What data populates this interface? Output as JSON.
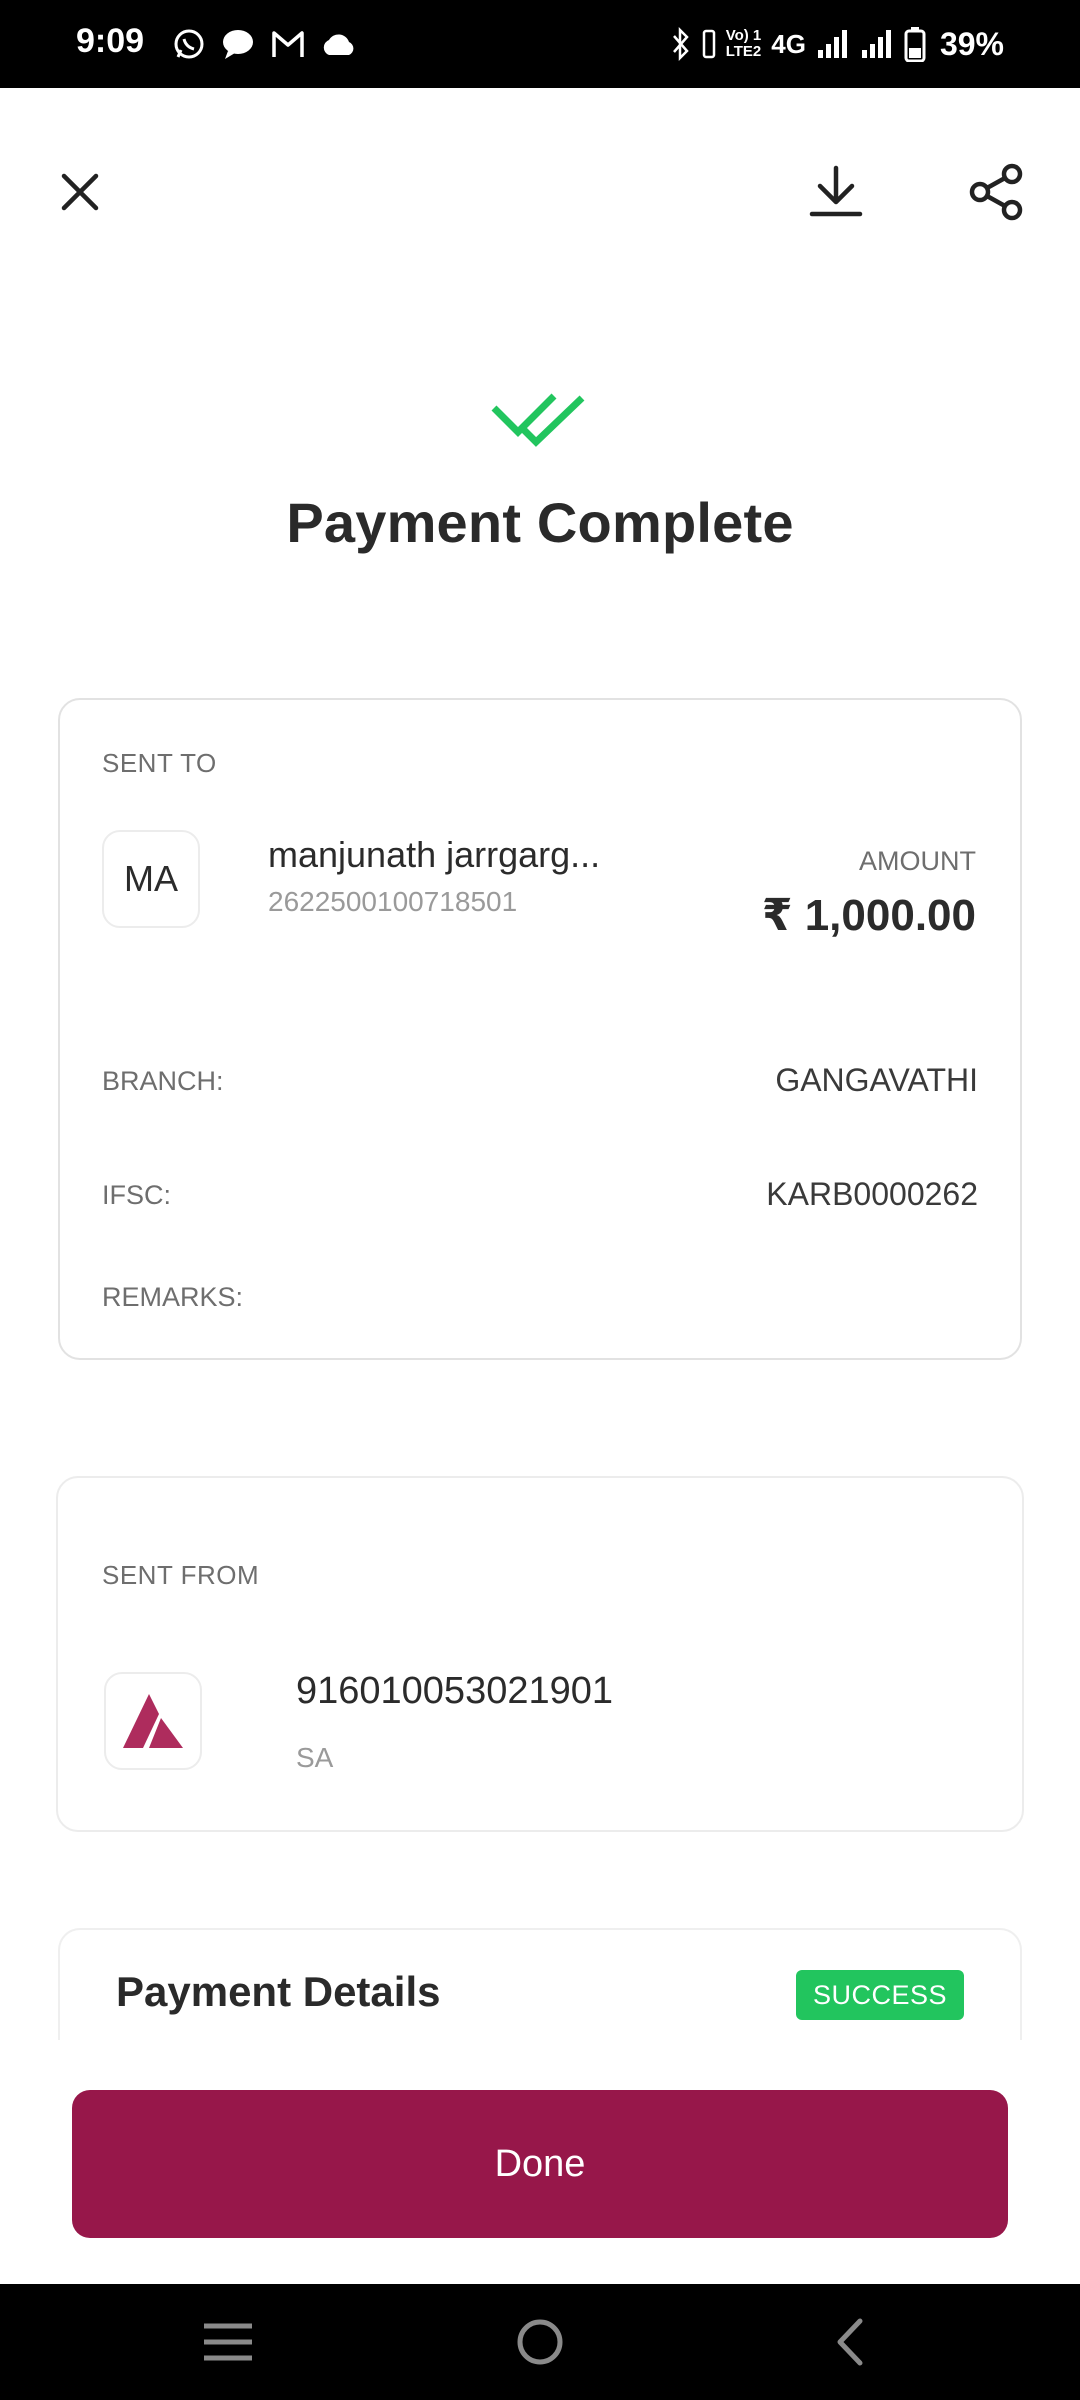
{
  "status_bar": {
    "time": "9:09",
    "network": "4G",
    "lte_line1": "Vo) 1",
    "lte_line2": "LTE2",
    "battery": "39%",
    "left_icons": [
      "whatsapp-icon",
      "message-icon",
      "gmail-icon",
      "cloud-icon"
    ],
    "right_icons": [
      "bluetooth-icon",
      "vibrate-icon",
      "signal-icon",
      "signal-icon",
      "battery-icon"
    ]
  },
  "toolbar": {
    "close_icon": "close-icon",
    "download_icon": "download-icon",
    "share_icon": "share-icon"
  },
  "header": {
    "title": "Payment Complete",
    "icon": "double-check-icon",
    "accent": "#22c55e"
  },
  "sent_to": {
    "label": "SENT TO",
    "avatar_initials": "MA",
    "name": "manjunath jarrgarg...",
    "account": "2622500100718501",
    "amount_label": "AMOUNT",
    "amount": "₹ 1,000.00",
    "rows": [
      {
        "label": "BRANCH:",
        "value": "GANGAVATHI"
      },
      {
        "label": "IFSC:",
        "value": "KARB0000262"
      },
      {
        "label": "REMARKS:",
        "value": ""
      }
    ]
  },
  "sent_from": {
    "label": "SENT FROM",
    "bank_icon": "axis-bank-logo",
    "account": "916010053021901",
    "type": "SA"
  },
  "payment_details": {
    "title": "Payment Details",
    "status": "SUCCESS",
    "status_color": "#22c55e"
  },
  "actions": {
    "done_label": "Done",
    "done_color": "#97174a"
  },
  "nav_bar": {
    "items": [
      "menu-icon",
      "home-icon",
      "back-icon"
    ]
  }
}
